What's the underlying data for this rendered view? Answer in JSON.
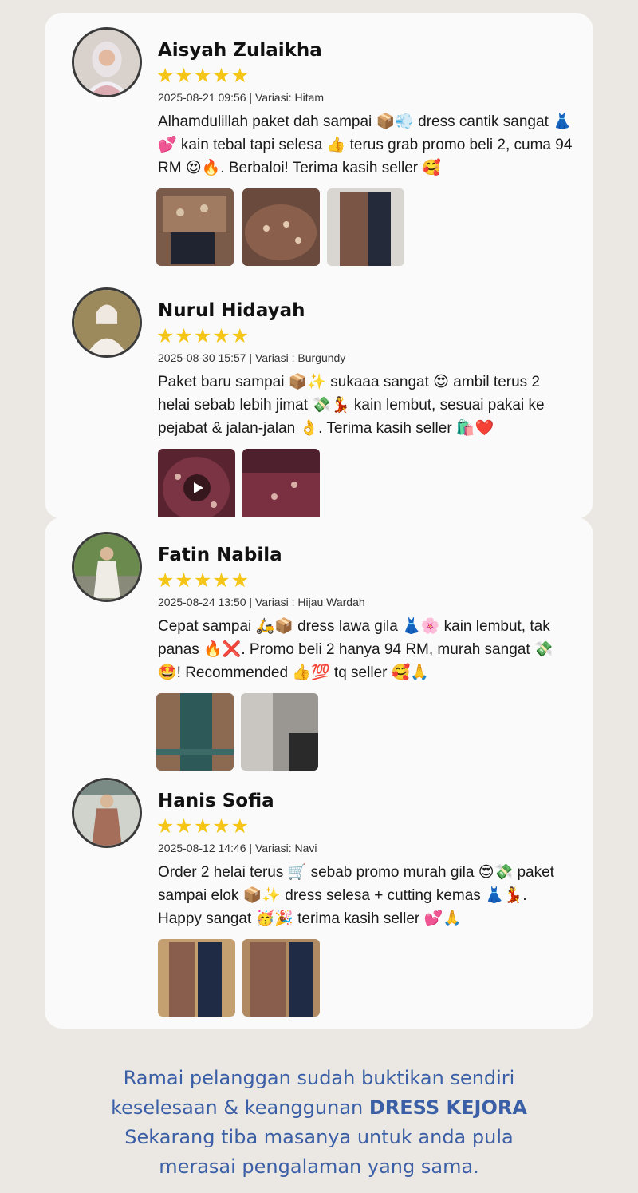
{
  "reviews": [
    {
      "name": "Aisyah Zulaikha",
      "stars": "★★★★★",
      "rating": 5,
      "meta": "2025-08-21 09:56 | Variasi: Hitam",
      "text": "Alhamdulillah paket dah sampai 📦💨 dress cantik sangat 👗💕 kain tebal tapi selesa 👍 terus grab promo beli 2, cuma 94 RM 😍🔥. Berbaloi! Terima kasih seller 🥰"
    },
    {
      "name": "Nurul Hidayah",
      "stars": "★★★★★",
      "rating": 5,
      "meta": "2025-08-30 15:57 | Variasi : Burgundy",
      "text": "Paket baru sampai 📦✨ sukaaa sangat 😍 ambil terus 2 helai sebab lebih jimat 💸💃 kain lembut, sesuai pakai ke pejabat & jalan-jalan 👌. Terima kasih seller 🛍️❤️"
    },
    {
      "name": "Fatin Nabila",
      "stars": "★★★★★",
      "rating": 5,
      "meta": "2025-08-24 13:50 | Variasi : Hijau Wardah",
      "text": "Cepat sampai 🛵📦 dress lawa gila 👗🌸 kain lembut, tak panas 🔥❌. Promo beli 2 hanya 94 RM, murah sangat 💸🤩! Recommended 👍💯 tq seller 🥰🙏"
    },
    {
      "name": "Hanis Sofia",
      "stars": "★★★★★",
      "rating": 5,
      "meta": "2025-08-12 14:46 | Variasi: Navi",
      "text": "Order 2 helai terus 🛒 sebab promo murah gila 😍💸 paket sampai elok 📦✨ dress selesa + cutting kemas 👗💃. Happy sangat 🥳🎉 terima kasih seller 💕🙏"
    }
  ],
  "footer": {
    "line1": "Ramai pelanggan sudah buktikan sendiri",
    "line2_prefix": "keselesaan & keanggunan ",
    "line2_brand": "DRESS KEJORA",
    "line3": "Sekarang tiba masanya untuk anda pula",
    "line4": "merasai pengalaman yang sama."
  },
  "colors": {
    "star": "#f5c518",
    "footer_text": "#3b5fa6",
    "background": "#ebe8e3",
    "card": "#fafafa"
  },
  "icons": {
    "play": "play-icon",
    "star": "star-icon"
  }
}
